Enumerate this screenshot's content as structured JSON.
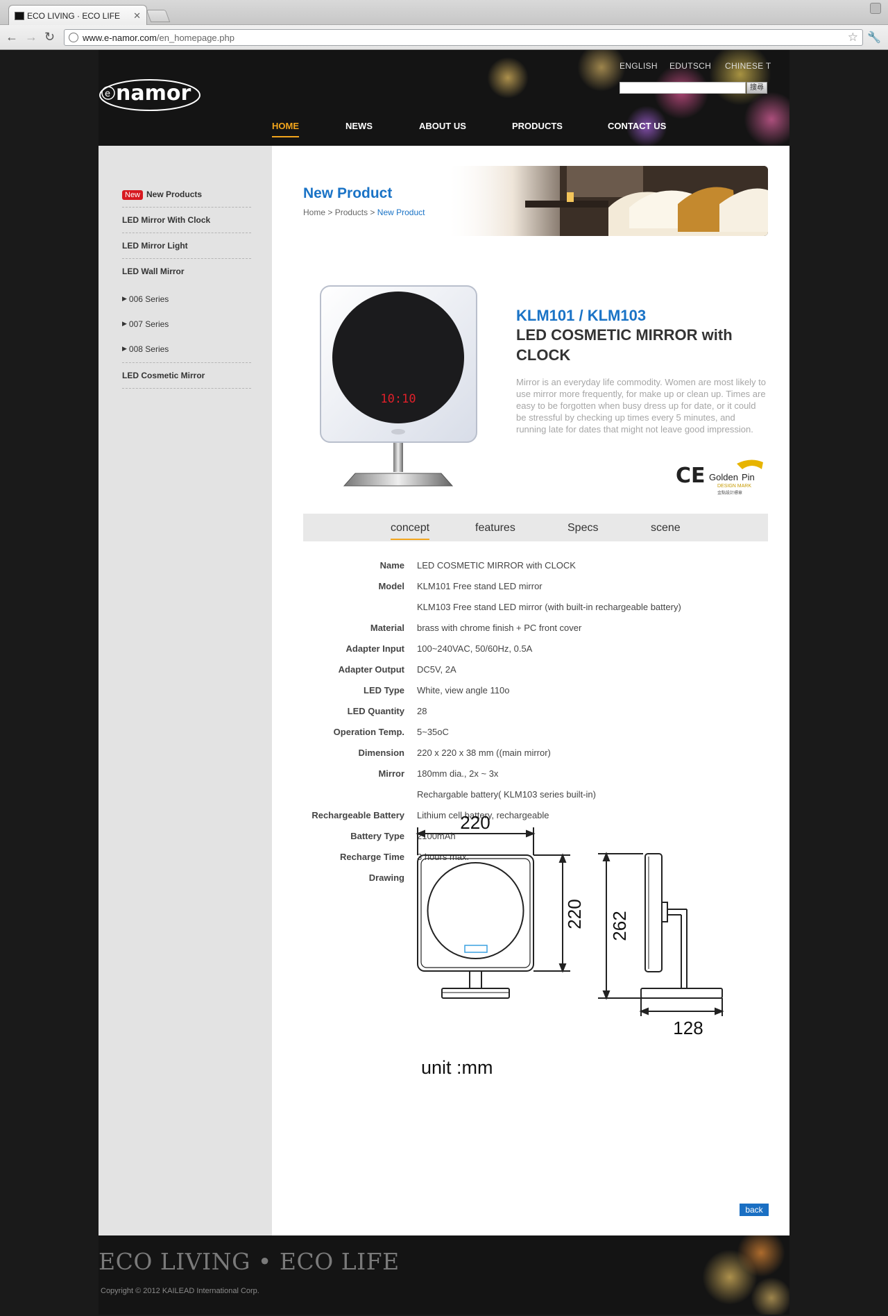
{
  "browser": {
    "tab_title": "ECO LIVING · ECO LIFE",
    "url_host": "www.e-namor.com",
    "url_path": "/en_homepage.php"
  },
  "header": {
    "logo_text": "enamor",
    "languages": [
      "ENGLISH",
      "EDUTSCH",
      "CHINESE T"
    ],
    "search_button": "搜尋",
    "nav": [
      "HOME",
      "NEWS",
      "ABOUT US",
      "PRODUCTS",
      "CONTACT US"
    ]
  },
  "sidebar": {
    "new_badge": "New",
    "items": [
      "New Products",
      "LED Mirror With Clock",
      "LED Mirror Light",
      "LED Wall Mirror"
    ],
    "subitems": [
      "006 Series",
      "007 Series",
      "008 Series"
    ],
    "last_item": "LED Cosmetic Mirror"
  },
  "banner": {
    "title": "New Product",
    "crumbs": [
      "Home",
      ">",
      "Products",
      ">",
      "New Product"
    ]
  },
  "product": {
    "code": "KLM101 / KLM103",
    "name": "LED COSMETIC MIRROR with CLOCK",
    "description": "Mirror is an everyday life commodity. Women are most likely to use mirror more frequently, for make up or clean up. Times are easy to be forgotten when busy dress up for date, or it could be stressful by checking up times every 5 minutes, and running late for dates that might not leave good impression.",
    "clock_display": "10:10",
    "cert_ce": "CE",
    "goldenpin": [
      "Golden",
      "Pin",
      "DESIGN MARK",
      "金點設計標章"
    ]
  },
  "tabs": [
    "concept",
    "features",
    "Specs",
    "scene"
  ],
  "specs": [
    {
      "label": "Name",
      "value": "LED COSMETIC MIRROR with CLOCK"
    },
    {
      "label": "Model",
      "value": "KLM101 Free stand LED mirror"
    },
    {
      "label": "",
      "value": "KLM103 Free stand LED mirror (with built-in rechargeable battery)"
    },
    {
      "label": "Material",
      "value": "brass with chrome finish + PC front cover"
    },
    {
      "label": "Adapter Input",
      "value": "100~240VAC, 50/60Hz, 0.5A"
    },
    {
      "label": "Adapter Output",
      "value": "DC5V, 2A"
    },
    {
      "label": "LED Type",
      "value": "White, view angle 110o"
    },
    {
      "label": "LED Quantity",
      "value": "28"
    },
    {
      "label": "Operation Temp.",
      "value": "5~35oC"
    },
    {
      "label": "Dimension",
      "value": "220 x 220 x 38 mm ((main mirror)"
    },
    {
      "label": "Mirror",
      "value": "180mm dia., 2x ~ 3x"
    },
    {
      "label": "",
      "value": "Rechargable battery( KLM103 series built-in)"
    },
    {
      "label": "Rechargeable Battery",
      "value": "Lithium cell battery, rechargeable"
    },
    {
      "label": "Battery Type",
      "value": "2100mAh"
    },
    {
      "label": "Recharge Time",
      "value": "3 hours max."
    },
    {
      "label": "Drawing",
      "value": ""
    }
  ],
  "drawing": {
    "width_label": "220",
    "height_label": "220",
    "total_height_label": "262",
    "depth_label": "128",
    "unit_label": "unit :mm"
  },
  "back_label": "back",
  "footer": {
    "slogan": "ECO LIVING • ECO LIFE",
    "copyright": "Copyright ©  2012 KAILEAD International Corp."
  },
  "colors": {
    "accent_blue": "#1a73c6",
    "nav_active": "#f2a51c",
    "new_badge": "#d71920"
  }
}
